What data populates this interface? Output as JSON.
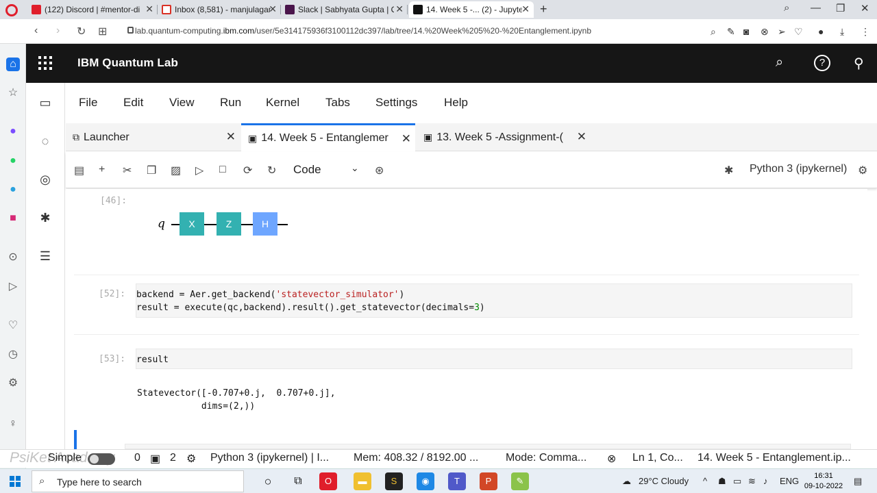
{
  "browser": {
    "tabs": [
      {
        "label": "(122) Discord | #mentor-di",
        "favicon_color": "#e01e2b"
      },
      {
        "label": "Inbox (8,581) - manjulagan",
        "favicon_color": "#d93025"
      },
      {
        "label": "Slack | Sabhyata Gupta | Q",
        "favicon_color": "#4a154b"
      },
      {
        "label": "14. Week 5 -... (2) - Jupyte",
        "favicon_color": "#111111"
      }
    ],
    "new_tab": "+",
    "url_prefix": "lab.quantum-computing.",
    "url_host": "ibm.com",
    "url_path": "/user/5e314175936f3100112dc397/lab/tree/14.%20Week%205%20-%20Entanglement.ipynb"
  },
  "ibm_header": {
    "title": "IBM Quantum Lab"
  },
  "menu": [
    "File",
    "Edit",
    "View",
    "Run",
    "Kernel",
    "Tabs",
    "Settings",
    "Help"
  ],
  "notebook_tabs": [
    {
      "label": "Launcher",
      "icon": "launcher-icon"
    },
    {
      "label": "14. Week 5 - Entanglemer",
      "icon": "notebook-icon"
    },
    {
      "label": "13. Week 5 -Assignment-(",
      "icon": "notebook-icon"
    }
  ],
  "toolbar": {
    "cell_type": "Code",
    "kernel": "Python 3 (ipykernel)"
  },
  "cells": {
    "c46": {
      "prompt": "[46]:",
      "circuit": {
        "qubit": "q",
        "gates": [
          "X",
          "Z",
          "H"
        ],
        "gate_colors": [
          "#33b1b1",
          "#33b1b1",
          "#6ea6ff"
        ]
      }
    },
    "c52": {
      "prompt": "[52]:",
      "line1_a": "backend = Aer.get_backend(",
      "line1_str": "'statevector_simulator'",
      "line1_b": ")",
      "line2_a": "result = execute(qc,backend).result().get_statevector(decimals=",
      "line2_num": "3",
      "line2_b": ")"
    },
    "c53": {
      "prompt": "[53]:",
      "input": "result",
      "output_line1": "Statevector([-0.707+0.j,  0.707+0.j],",
      "output_line2": "            dims=(2,))"
    }
  },
  "statusbar": {
    "watermark": "PsiKet Academy",
    "mode_label": "Simple",
    "count_a": "0",
    "count_b": "2",
    "kernel": "Python 3 (ipykernel) | I...",
    "mem": "Mem: 408.32 / 8192.00 ...",
    "mode": "Mode: Comma...",
    "position": "Ln 1, Co...",
    "filename": "14. Week 5 - Entanglement.ip..."
  },
  "taskbar": {
    "search_placeholder": "Type here to search",
    "weather": "29°C Cloudy",
    "language": "ENG",
    "time": "16:31",
    "date": "09-10-2022"
  }
}
